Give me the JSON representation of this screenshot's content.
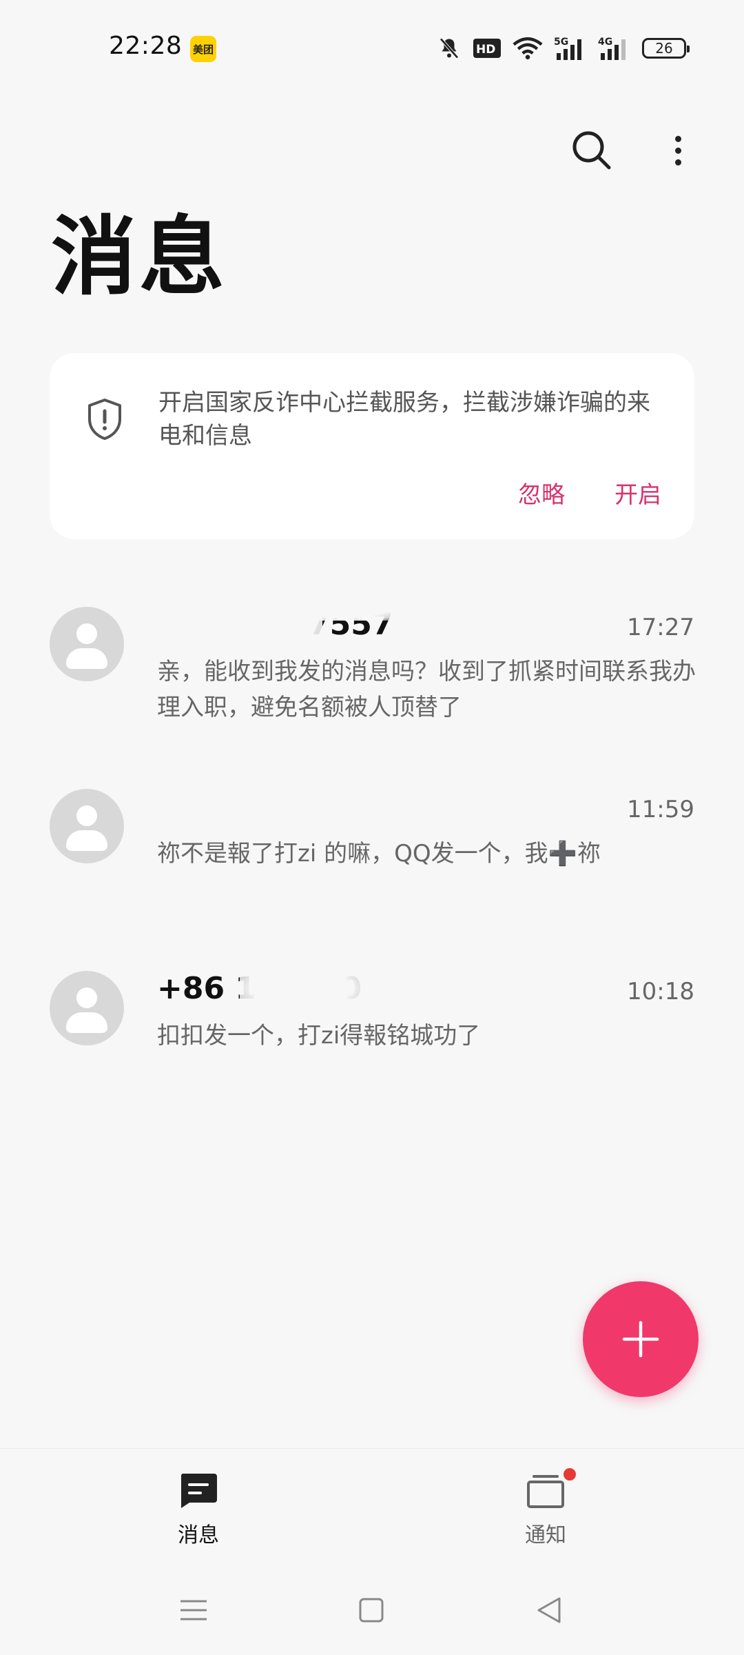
{
  "status_bar": {
    "time": "22:28",
    "app_badge": "美团",
    "battery_level": "26",
    "network_labels": [
      "HD",
      "5G",
      "4G"
    ],
    "icons": [
      "mute-bell-icon",
      "hd-icon",
      "wifi-icon",
      "5g-signal-icon",
      "4g-signal-icon",
      "battery-icon"
    ]
  },
  "header": {
    "title": "消息",
    "icons": [
      "search-icon",
      "more-vertical-icon"
    ]
  },
  "fraud_card": {
    "text": "开启国家反诈中心拦截服务，拦截涉嫌诈骗的来电和信息",
    "ignore_label": "忽略",
    "enable_label": "开启",
    "icon": "shield-alert-icon",
    "accent_color": "#d6336c"
  },
  "messages": [
    {
      "name": "7557",
      "time": "17:27",
      "preview": "亲，能收到我发的消息吗？收到了抓紧时间联系我办理入职，避免名额被人顶替了"
    },
    {
      "name": "",
      "time": "11:59",
      "preview": "祢不是報了打zi 的嘛，QQ发一个，我➕祢"
    },
    {
      "name": "+86 1      10",
      "time": "10:18",
      "preview": "扣扣发一个，打zi得報铭城功了"
    }
  ],
  "fab": {
    "icon": "plus-icon",
    "color": "#f0386a"
  },
  "bottom_nav": {
    "tabs": [
      {
        "label": "消息",
        "icon": "message-icon",
        "active": true
      },
      {
        "label": "通知",
        "icon": "notification-icon",
        "active": false,
        "has_badge": true
      }
    ]
  },
  "system_nav": {
    "icons": [
      "menu-icon",
      "home-icon",
      "back-icon"
    ]
  }
}
